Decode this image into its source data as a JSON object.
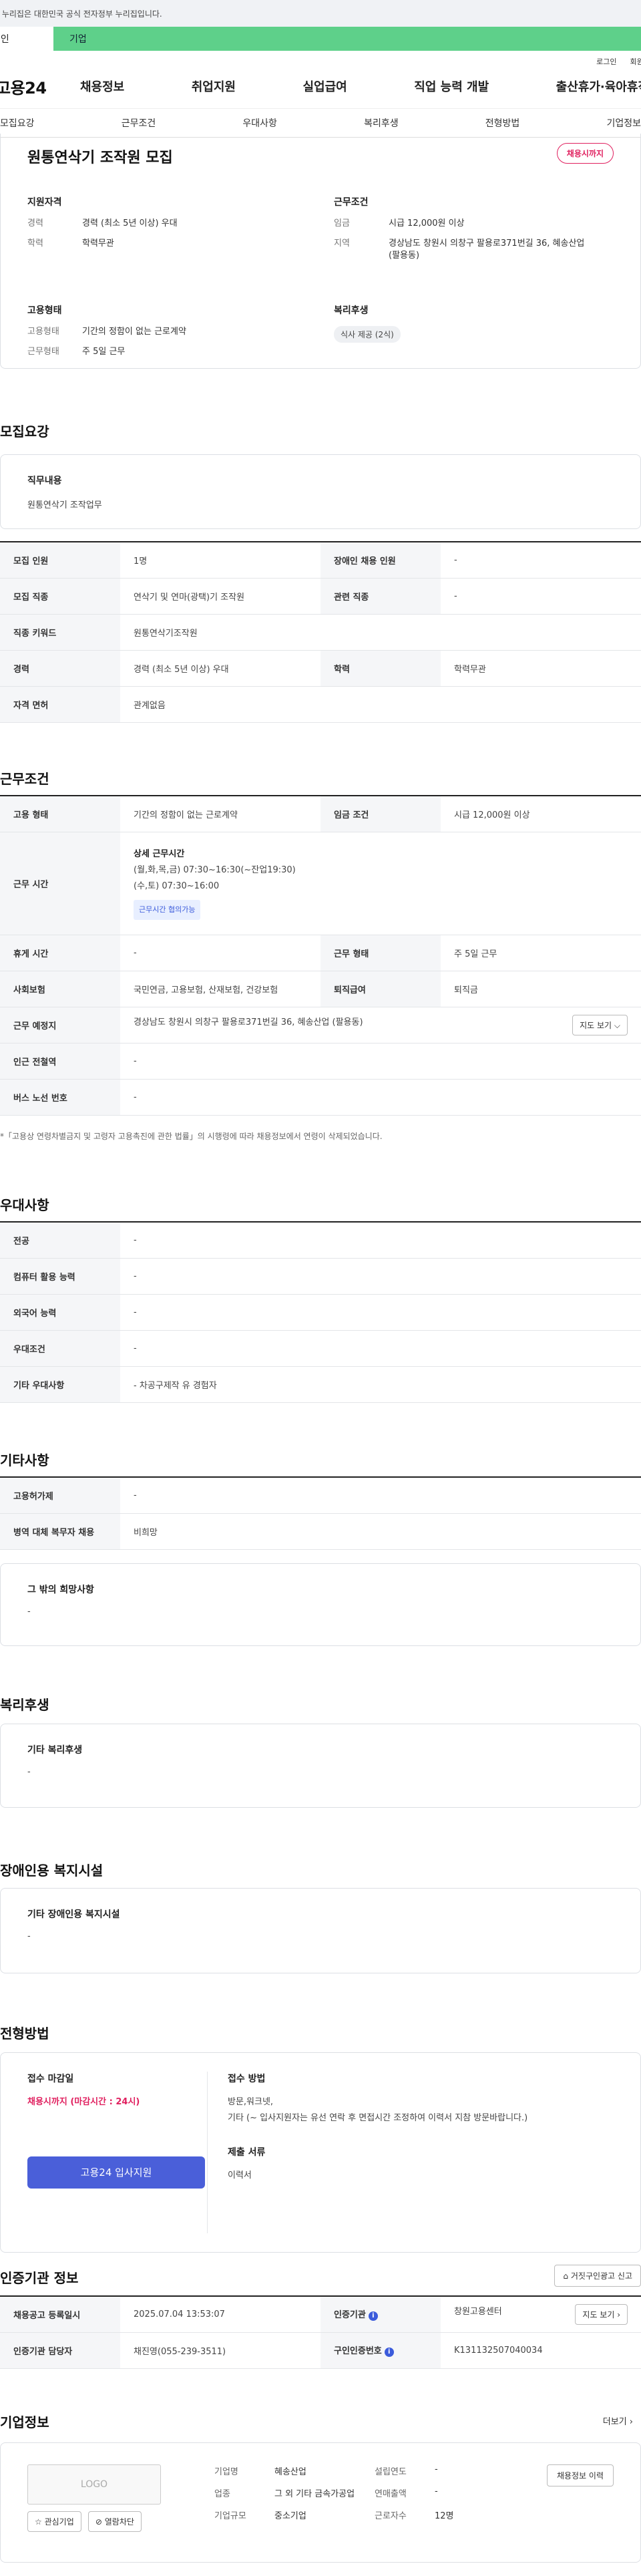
{
  "banner": {
    "text": "이 누리집은 대한민국 공식 전자정부 누리집입니다."
  },
  "site_tabs": {
    "personal": "개인",
    "company": "기업"
  },
  "util": {
    "login": "로그인",
    "join": "회원가입"
  },
  "gnb": {
    "logo": "고용24",
    "items": [
      "채용정보",
      "취업지원",
      "실업급여",
      "직업 능력 개발",
      "출산휴가·육아휴직"
    ]
  },
  "anchors": [
    "모집요강",
    "근무조건",
    "우대사항",
    "복리후생",
    "전형방법",
    "기업정보"
  ],
  "summary": {
    "title": "원통연삭기 조작원 모집",
    "status": "채용시까지",
    "qual": {
      "heading": "지원자격",
      "career_k": "경력",
      "career_v": "경력 (최소 5년 이상) 우대",
      "edu_k": "학력",
      "edu_v": "학력무관"
    },
    "cond": {
      "heading": "근무조건",
      "wage_k": "임금",
      "wage_v": "시급 12,000원 이상",
      "area_k": "지역",
      "area_v1": "경상남도 창원시 의창구 팔용로371번길 36, 혜송산업",
      "area_v2": "(팔용동)"
    },
    "emp": {
      "heading": "고용형태",
      "type_k": "고용형태",
      "type_v": "기간의 정함이 없는 근로계약",
      "shape_k": "근무형태",
      "shape_v": "주 5일 근무"
    },
    "welfare": {
      "heading": "복리후생",
      "chip": "식사 제공 (2식)"
    }
  },
  "recruit": {
    "heading": "모집요강",
    "duty_title": "직무내용",
    "duty_desc": "원통연삭기 조작업무",
    "rows": [
      {
        "k1": "모집 인원",
        "v1": "1명",
        "k2": "장애인 채용 인원",
        "v2": "-"
      },
      {
        "k1": "모집 직종",
        "v1": "연삭기 및 연마(광택)기 조작원",
        "k2": "관련 직종",
        "v2": "-"
      },
      {
        "k1": "직종 키워드",
        "v1": "원통연삭기조작원"
      },
      {
        "k1": "경력",
        "v1": "경력 (최소 5년 이상) 우대",
        "k2": "학력",
        "v2": "학력무관"
      },
      {
        "k1": "자격 면허",
        "v1": "관계없음"
      }
    ]
  },
  "work": {
    "heading": "근무조건",
    "emp_k": "고용 형태",
    "emp_v": "기간의 정함이 없는 근로계약",
    "wage_k": "임금 조건",
    "wage_v": "시급 12,000원 이상",
    "time_k": "근무 시간",
    "time_title": "상세 근무시간",
    "time_l1": "(월,화,목,금) 07:30~16:30(~잔업19:30)",
    "time_l2": "(수,토) 07:30~16:00",
    "time_badge": "근무시간 협의가능",
    "rest_k": "휴게 시간",
    "rest_v": "-",
    "shape_k": "근무 형태",
    "shape_v": "주 5일 근무",
    "ins_k": "사회보험",
    "ins_v": "국민연금, 고용보험, 산재보험, 건강보험",
    "ret_k": "퇴직급여",
    "ret_v": "퇴직금",
    "place_k": "근무 예정지",
    "place_v": "경상남도 창원시 의창구 팔용로371번길 36, 혜송산업 (팔용동)",
    "map_btn": "지도 보기 ⌵",
    "station_k": "인근 전철역",
    "station_v": "-",
    "bus_k": "버스 노선 번호",
    "bus_v": "-",
    "note": "*「고용상 연령차별금지 및 고령자 고용촉진에 관한 법률」의 시행령에 따라 채용정보에서 연령이 삭제되었습니다."
  },
  "pref": {
    "heading": "우대사항",
    "rows": [
      {
        "k": "전공",
        "v": "-"
      },
      {
        "k": "컴퓨터 활용 능력",
        "v": "-"
      },
      {
        "k": "외국어 능력",
        "v": "-"
      },
      {
        "k": "우대조건",
        "v": "-"
      },
      {
        "k": "기타 우대사항",
        "v": "- 차공구제작 유 경험자"
      }
    ]
  },
  "etc": {
    "heading": "기타사항",
    "rows": [
      {
        "k": "고용허가제",
        "v": "-"
      },
      {
        "k": "병역 대체 복무자 채용",
        "v": "비희망"
      }
    ],
    "other_title": "그 밖의 희망사항",
    "other_value": "-"
  },
  "welfare": {
    "heading": "복리후생",
    "title": "기타 복리후생",
    "value": "-"
  },
  "disability": {
    "heading": "장애인용 복지시설",
    "title": "기타 장애인용 복지시설",
    "value": "-"
  },
  "selection": {
    "heading": "전형방법",
    "deadline_title": "접수 마감일",
    "deadline_value": "채용시까지 (마감시간 : 24시)",
    "apply_btn": "고용24 입사지원",
    "method_title": "접수 방법",
    "method_l1": "방문,워크넷,",
    "method_l2": "기타 (~ 입사지원자는 유선 연락 후 면접시간 조정하여 이력서 지참 방문바랍니다.)",
    "docs_title": "제출 서류",
    "docs_value": "이력서"
  },
  "agency": {
    "heading": "인증기관 정보",
    "report_btn": "거짓구인광고 신고",
    "reg_k": "채용공고 등록일시",
    "reg_v": "2025.07.04 13:53:07",
    "cert_k": "인증기관",
    "cert_v": "창원고용센터",
    "map_btn": "지도 보기 ›",
    "mgr_k": "인증기관 담당자",
    "mgr_v": "채진영(055-239-3511)",
    "num_k": "구인인증번호",
    "num_v": "K131132507040034"
  },
  "company": {
    "heading": "기업정보",
    "more": "더보기 ›",
    "logo": "LOGO",
    "fav_btn": "☆ 관심기업",
    "block_btn": "⊘ 열람차단",
    "name_k": "기업명",
    "name_v": "혜송산업",
    "ind_k": "업종",
    "ind_v": "그 외 기타 금속가공업",
    "size_k": "기업규모",
    "size_v": "중소기업",
    "est_k": "설립연도",
    "est_v": "-",
    "sales_k": "연매출액",
    "sales_v": "-",
    "emp_k": "근로자수",
    "emp_v": "12명",
    "history_btn": "채용정보 이력"
  }
}
